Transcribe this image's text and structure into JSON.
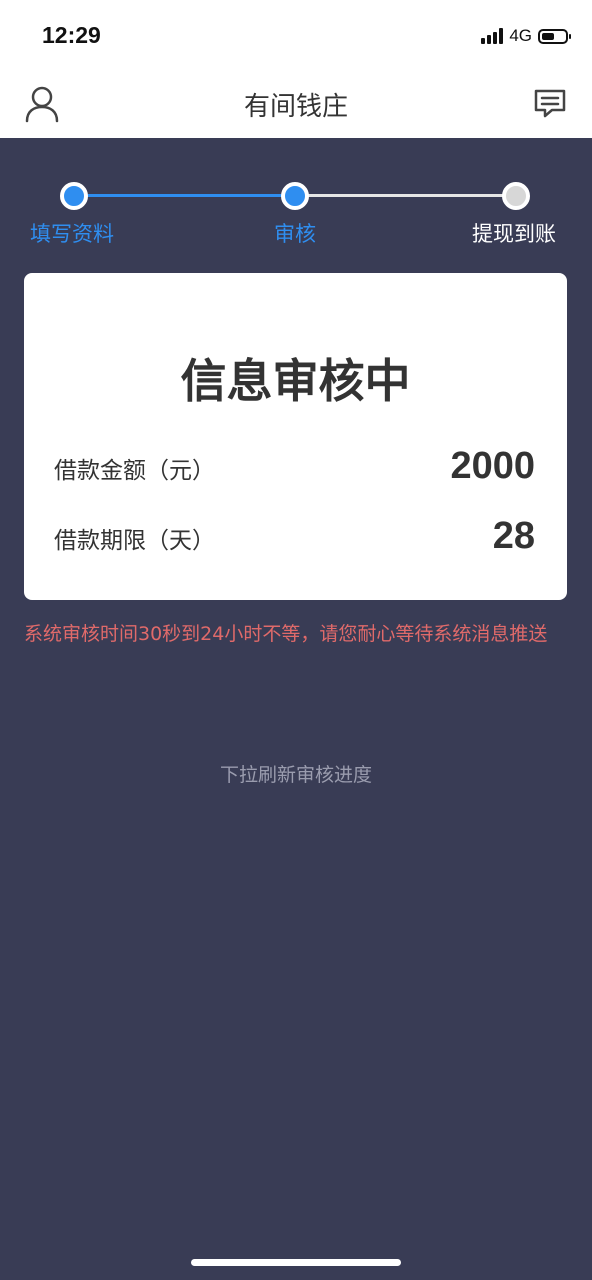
{
  "status_bar": {
    "time": "12:29",
    "network": "4G",
    "battery_level": 0.55
  },
  "navbar": {
    "title": "有间钱庄",
    "left_icon": "user-icon",
    "right_icon": "message-icon"
  },
  "steps": {
    "items": [
      {
        "label": "填写资料",
        "state": "active"
      },
      {
        "label": "审核",
        "state": "active"
      },
      {
        "label": "提现到账",
        "state": "inactive"
      }
    ],
    "active_color": "#2f8ef0",
    "inactive_color": "#d7d7d7"
  },
  "card": {
    "title": "信息审核中",
    "rows": [
      {
        "label": "借款金额（元）",
        "value": "2000"
      },
      {
        "label": "借款期限（天）",
        "value": "28"
      }
    ]
  },
  "notice": "系统审核时间30秒到24小时不等，请您耐心等待系统消息推送",
  "pull_hint": "下拉刷新审核进度",
  "colors": {
    "background": "#393c55",
    "notice": "#e06a6a"
  }
}
